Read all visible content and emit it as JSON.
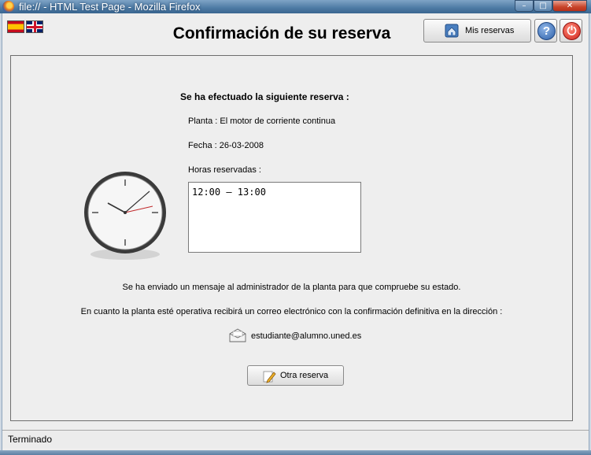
{
  "window": {
    "title": "file:// - HTML Test Page - Mozilla Firefox",
    "minimize_glyph": "–",
    "maximize_glyph": "□",
    "close_glyph": "✕"
  },
  "header": {
    "title": "Confirmación de su reserva",
    "flags": [
      "spain-flag-icon",
      "uk-flag-icon"
    ],
    "mis_reservas_label": "Mis reservas",
    "help_glyph": "?",
    "exit_glyph": "⏻"
  },
  "reservation": {
    "heading": "Se ha efectuado la siguiente reserva :",
    "planta": "Planta : El motor de corriente continua",
    "fecha": "Fecha : 26-03-2008",
    "horas_label": "Horas reservadas :",
    "horas_value": "12:00 – 13:00"
  },
  "messages": {
    "admin_msg": "Se ha enviado un mensaje al administrador de la planta para que compruebe su estado.",
    "confirm_msg": "En cuanto la planta esté operativa recibirá un correo electrónico con la confirmación definitiva en la dirección :",
    "email": "estudiante@alumno.uned.es"
  },
  "actions": {
    "otra_reserva_label": "Otra reserva"
  },
  "status": {
    "text": "Terminado"
  }
}
